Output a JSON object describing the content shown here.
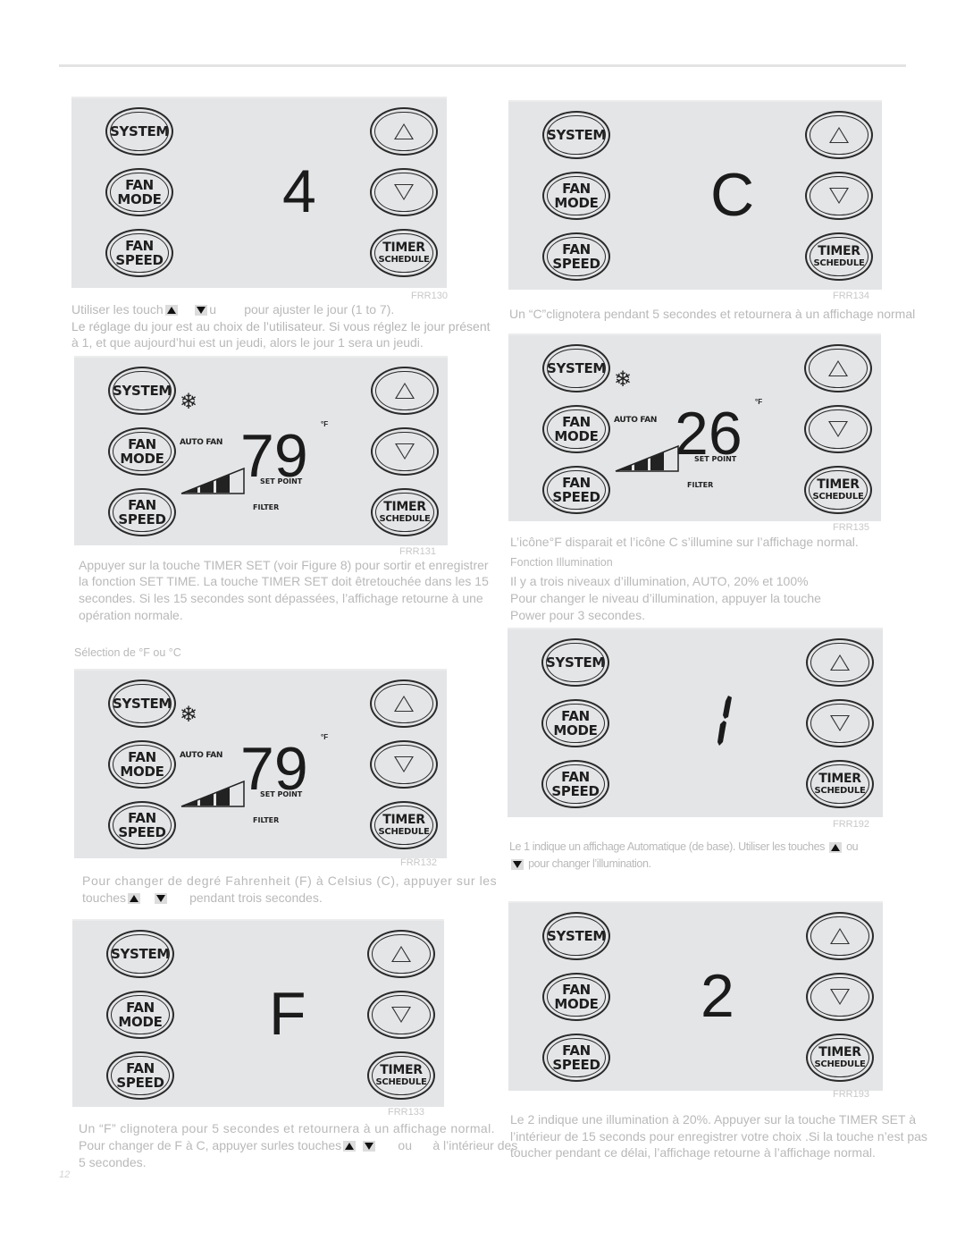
{
  "buttons": {
    "system": "SYSTEM",
    "fan_mode_1": "FAN",
    "fan_mode_2": "MODE",
    "fan_speed_1": "FAN",
    "fan_speed_2": "SPEED",
    "timer_1": "TIMER",
    "timer_2": "SCHEDULE",
    "up_icon": "triangle-up",
    "down_icon": "triangle-down"
  },
  "display_labels": {
    "auto_fan": "AUTO FAN",
    "set_point": "SET POINT",
    "filter": "FILTER",
    "deg_f": "°F",
    "snowflake": "❄"
  },
  "panels": [
    {
      "id": "FRR130",
      "display": "4",
      "figure": "FRR130"
    },
    {
      "id": "FRR134",
      "display": "C",
      "figure": "FRR134"
    },
    {
      "id": "FRR131",
      "display": "79",
      "figure": "FRR131",
      "fan_level_bars": 3
    },
    {
      "id": "FRR135",
      "display": "26",
      "figure": "FRR135",
      "fan_level_bars": 3
    },
    {
      "id": "FRR132",
      "display": "79",
      "figure": "FRR132",
      "fan_level_bars": 3
    },
    {
      "id": "FRR192",
      "display": "1",
      "figure": "FRR192"
    },
    {
      "id": "FRR133",
      "display": "F",
      "figure": "FRR133"
    },
    {
      "id": "FRR193",
      "display": "2",
      "figure": "FRR193"
    }
  ],
  "text": {
    "p130_l1a": "Utiliser les touch",
    "p130_l1b": "u",
    "p130_l1c": "pour ajuster le jour (1 to 7).",
    "p130_l2": "Le réglage du jour est au choix de l’utilisateur. Si vous réglez le jour présent",
    "p130_l3": "à 1, et que aujourd’hui est un jeudi, alors le jour 1 sera un jeudi.",
    "p134": "Un “C”clignotera pendant 5 secondes et retournera à un affichage normal",
    "p131_l1": "Appuyer sur la touche TIMER SET (voir Figure 8) pour sortir et enregistrer",
    "p131_l2": "la fonction SET TIME. La touche TIMER SET doit êtretouchée dans les 15",
    "p131_l3": "secondes. Si les 15 secondes sont dépassées, l’affichage retourne à une",
    "p131_l4": "opération normale.",
    "p135": "L’icône°F disparait et l’icône C s’illumine sur l’affichage normal.",
    "illum_title": "Fonction Illumination",
    "illum_l1": "Il y a trois niveaux d’illumination, AUTO, 20% et 100%",
    "illum_l2": "Pour changer le niveau d’illumination, appuyer la touche",
    "illum_l3": "Power pour 3 secondes.",
    "sel_heading": "Sélection de °F ou °C",
    "p132_l1": "Pour changer de degré Fahrenheit (F) à Celsius (C), appuyer sur les",
    "p132_l2a": "touches",
    "p132_l2b": "pendant trois secondes.",
    "p192_l1": "Le 1 indique un affichage Automatique (de base). Utiliser les touches",
    "p192_l1b": "ou",
    "p192_l2": "pour changer l’illumination.",
    "p133_l1": "Un “F” clignotera pour 5 secondes et retournera à un affichage normal.",
    "p133_l2a": "Pour changer de F à C, appuyer surles touches",
    "p133_l2b": "ou",
    "p133_l2c": "à l’intérieur des",
    "p133_l3": "5 secondes.",
    "p193_l1": "Le 2 indique une illumination à 20%. Appuyer sur la touche TIMER SET à",
    "p193_l2": "l’intérieur de 15 seconds pour enregistrer votre choix .Si la touche n’est pas",
    "p193_l3": "toucher pendant ce délai, l’affichage retourne à l’affichage normal."
  },
  "page_number": "12"
}
